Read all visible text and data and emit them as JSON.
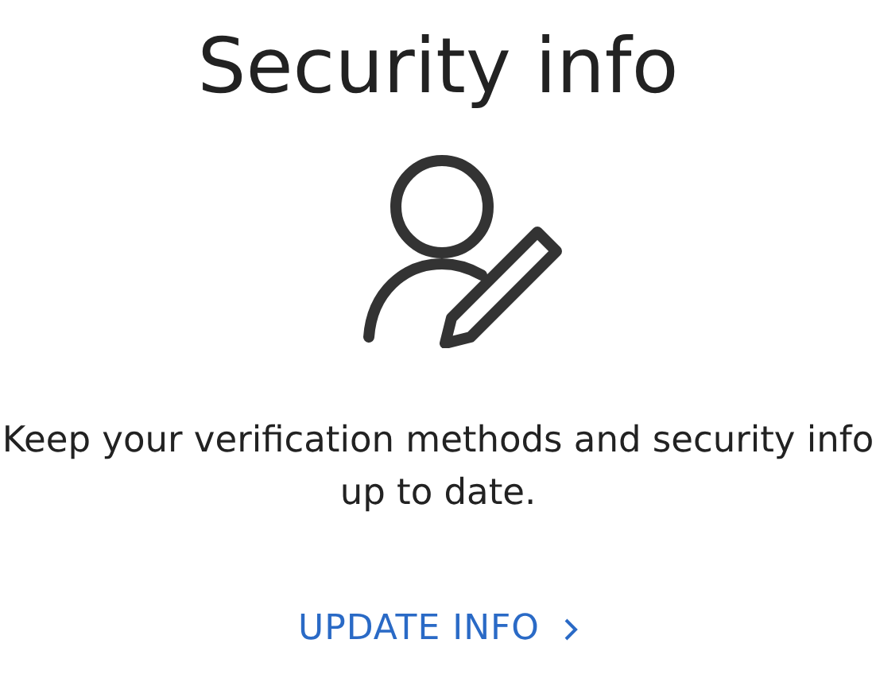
{
  "title": "Security info",
  "description": "Keep your verification methods and security info up to date.",
  "link": {
    "label": "UPDATE INFO"
  }
}
